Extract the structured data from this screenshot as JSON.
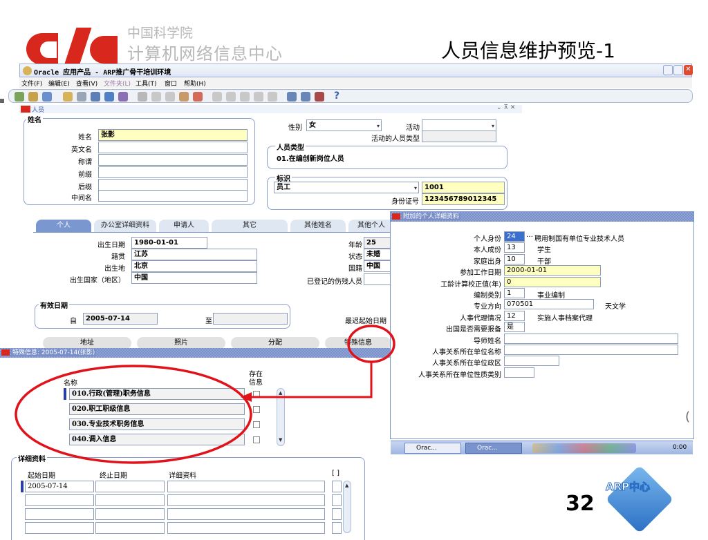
{
  "slide": {
    "org_top": "中国科学院",
    "org_bottom": "计算机网络信息中心",
    "title": "人员信息维护预览-1",
    "page_number": "32",
    "badge_text": "ARP中心"
  },
  "app": {
    "window_title": "Oracle 应用产品 - ARP推广骨干培训环境",
    "menu": [
      "文件(F)",
      "编辑(E)",
      "查看(V)",
      "文件夹(L)",
      "工具(T)",
      "窗口",
      "帮助(H)"
    ],
    "help_icon": "?"
  },
  "person_form": {
    "window_title": "人员",
    "name_group": "姓名",
    "labels": {
      "name": "姓名",
      "english_name": "英文名",
      "title": "称谓",
      "prefix": "前缀",
      "suffix": "后缀",
      "middle_name": "中间名"
    },
    "values": {
      "name": "张影"
    },
    "gender_label": "性别",
    "gender_value": "女",
    "active_label": "活动",
    "active_type_label": "活动的人员类型",
    "person_type_group": "人员类型",
    "person_type_value": "01.在编创新岗位人员",
    "id_group": "标识",
    "id_type_value": "员工",
    "id_number": "1001",
    "id_card_label": "身份证号",
    "id_card_value": "123456789012345",
    "tabs": [
      "个人",
      "办公室详细资料",
      "申请人",
      "其它",
      "其他姓名",
      "其他个人"
    ],
    "personal": {
      "birth_date_label": "出生日期",
      "birth_date": "1980-01-01",
      "native_label": "籍贯",
      "native": "江苏",
      "birthplace_label": "出生地",
      "birthplace": "北京",
      "birth_country_label": "出生国家（地区）",
      "birth_country": "中国",
      "age_label": "年龄",
      "age": "25",
      "status_label": "状态",
      "status": "未婚",
      "nationality_label": "国籍",
      "nationality": "中国",
      "disabled_label": "已登记的伤残人员"
    },
    "valid_group": "有效日期",
    "valid_from_label": "自",
    "valid_from": "2005-07-14",
    "valid_to_label": "至",
    "latest_start_label": "最迟起始日期",
    "bottom_buttons": [
      "地址",
      "照片",
      "分配",
      "特殊信息"
    ]
  },
  "extra_details": {
    "window_title": "附加的个人详细资料",
    "rows": [
      {
        "label": "个人身份",
        "code": "24",
        "desc": "聘用制国有单位专业技术人员"
      },
      {
        "label": "本人成份",
        "code": "13",
        "desc": "学生"
      },
      {
        "label": "家庭出身",
        "code": "10",
        "desc": "干部"
      },
      {
        "label": "参加工作日期",
        "code": "2000-01-01",
        "desc": ""
      },
      {
        "label": "工龄计算校正值(年)",
        "code": "0",
        "desc": ""
      },
      {
        "label": "编制类别",
        "code": "1",
        "desc": "事业编制"
      },
      {
        "label": "专业方向",
        "code": "070501",
        "desc": "天文学"
      },
      {
        "label": "人事代理情况",
        "code": "12",
        "desc": "实施人事档案代理"
      },
      {
        "label": "出国是否需要报备",
        "code": "是",
        "desc": ""
      },
      {
        "label": "导师姓名",
        "code": "",
        "desc": ""
      },
      {
        "label": "人事关系所在单位名称",
        "code": "",
        "desc": ""
      },
      {
        "label": "人事关系所在单位政区",
        "code": "",
        "desc": ""
      },
      {
        "label": "人事关系所在单位性质类别",
        "code": "",
        "desc": ""
      }
    ]
  },
  "special_info": {
    "window_title": "特殊信息: 2005-07-14(张影)",
    "col_name": "名称",
    "col_exists_1": "存在",
    "col_exists_2": "信息",
    "items": [
      "010.行政(管理)职务信息",
      "020.职工职级信息",
      "030.专业技术职务信息",
      "040.调入信息"
    ],
    "detail_group": "详细资料",
    "detail_cols": [
      "起始日期",
      "终止日期",
      "详细资料",
      "[ ]"
    ],
    "detail_first_date": "2005-07-14"
  },
  "taskbar": {
    "items": [
      "Orac...",
      "Orac..."
    ],
    "clock": "0:00"
  },
  "colors": {
    "accent_red": "#d8281e",
    "title_blue": "#3a5ea8",
    "highlight_red": "#e0121a"
  }
}
